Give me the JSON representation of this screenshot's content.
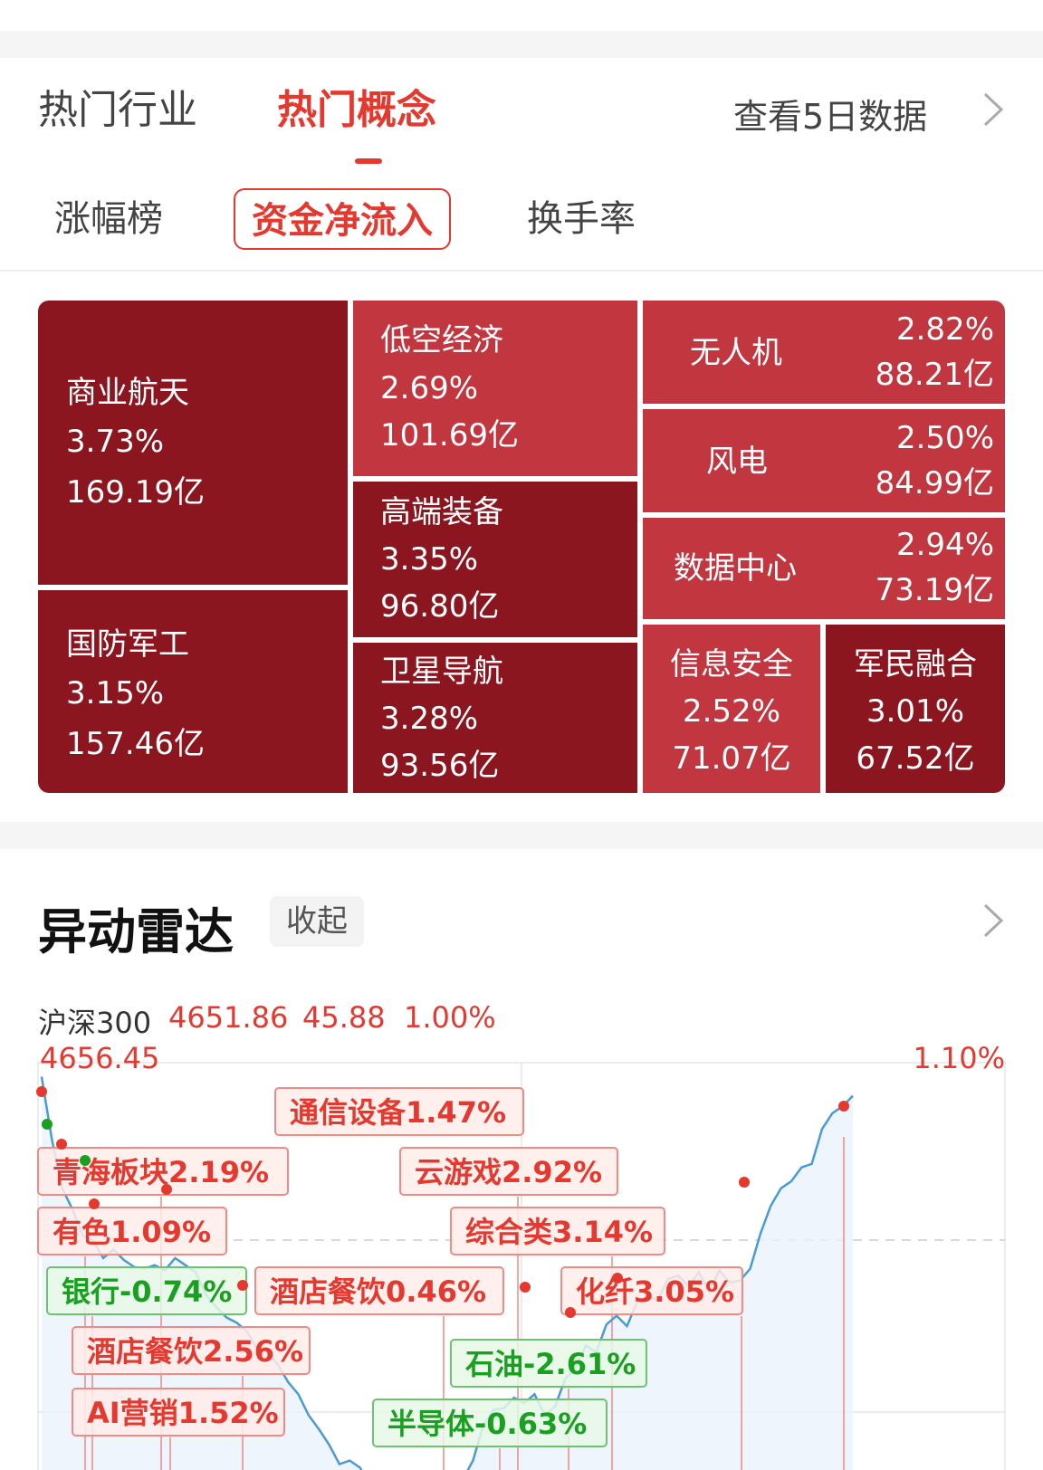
{
  "top_tabs": {
    "industry": "热门行业",
    "concept": "热门概念",
    "five_day": "查看5日数据"
  },
  "sub_tabs": {
    "rise": "涨幅榜",
    "inflow": "资金净流入",
    "turnover": "换手率"
  },
  "colors": {
    "accent": "#e5392f",
    "tile_dark": "#8c1620",
    "tile_mid": "#c1363f",
    "rise": "#e5392f",
    "fall": "#1aa020",
    "line": "#4a9ad6"
  },
  "heatmap": [
    {
      "name": "商业航天",
      "pct": "3.73%",
      "amount": "169.19亿"
    },
    {
      "name": "国防军工",
      "pct": "3.15%",
      "amount": "157.46亿"
    },
    {
      "name": "低空经济",
      "pct": "2.69%",
      "amount": "101.69亿"
    },
    {
      "name": "高端装备",
      "pct": "3.35%",
      "amount": "96.80亿"
    },
    {
      "name": "卫星导航",
      "pct": "3.28%",
      "amount": "93.56亿"
    },
    {
      "name": "无人机",
      "pct": "2.82%",
      "amount": "88.21亿"
    },
    {
      "name": "风电",
      "pct": "2.50%",
      "amount": "84.99亿"
    },
    {
      "name": "数据中心",
      "pct": "2.94%",
      "amount": "73.19亿"
    },
    {
      "name": "信息安全",
      "pct": "2.52%",
      "amount": "71.07亿"
    },
    {
      "name": "军民融合",
      "pct": "3.01%",
      "amount": "67.52亿"
    }
  ],
  "radar": {
    "title": "异动雷达",
    "collapse": "收起"
  },
  "index": {
    "name": "沪深300",
    "price": "4651.86",
    "change": "45.88",
    "pct": "1.00%"
  },
  "chart_data": {
    "type": "line",
    "y_top_label": "4656.45",
    "right_top_label": "1.10%",
    "series": [
      {
        "values": [
          4656.0,
          4652.4,
          4649.6,
          4648.4,
          4646.9,
          4646.6,
          4645.6,
          4646.1,
          4645.5,
          4645.1,
          4645.0,
          4645.2,
          4644.9,
          4645.6,
          4645.2,
          4644.8,
          4643.5,
          4642.8,
          4642.2,
          4641.9,
          4641.4,
          4640.4,
          4640.3,
          4639.5,
          4638.5,
          4637.8,
          4636.6,
          4635.8,
          4634.9,
          4633.8,
          4634.0,
          4633.6,
          4632.5,
          4632.2,
          4632.8,
          4632.0,
          4631.9,
          4633.0,
          4632.5,
          4630.8,
          4631.6,
          4632.9,
          4634.0,
          4636.0,
          4636.9,
          4637.0,
          4637.6,
          4637.3,
          4637.8,
          4636.6,
          4637.1,
          4638.7,
          4639.3,
          4640.6,
          4640.2,
          4641.8,
          4642.3,
          4641.7,
          4643.1,
          4643.4,
          4643.2,
          4644.4,
          4644.6,
          4644.0,
          4644.8,
          4643.7,
          4644.9,
          4644.2,
          4644.3,
          4645.0,
          4647.0,
          4648.6,
          4649.6,
          4650.0,
          4650.8,
          4651.0,
          4653.0,
          4653.9,
          4654.3,
          4654.9
        ]
      }
    ],
    "annotations": [
      {
        "label": "通信设备1.47%",
        "kind": "rise"
      },
      {
        "label": "青海板块2.19%",
        "kind": "rise"
      },
      {
        "label": "云游戏2.92%",
        "kind": "rise"
      },
      {
        "label": "有色1.09%",
        "kind": "rise"
      },
      {
        "label": "综合类3.14%",
        "kind": "rise"
      },
      {
        "label": "银行-0.74%",
        "kind": "fall"
      },
      {
        "label": "酒店餐饮0.46%",
        "kind": "rise"
      },
      {
        "label": "化纤3.05%",
        "kind": "rise"
      },
      {
        "label": "酒店餐饮2.56%",
        "kind": "rise"
      },
      {
        "label": "石油-2.61%",
        "kind": "fall"
      },
      {
        "label": "AI营销1.52%",
        "kind": "rise"
      },
      {
        "label": "半导体-0.63%",
        "kind": "fall"
      }
    ]
  }
}
